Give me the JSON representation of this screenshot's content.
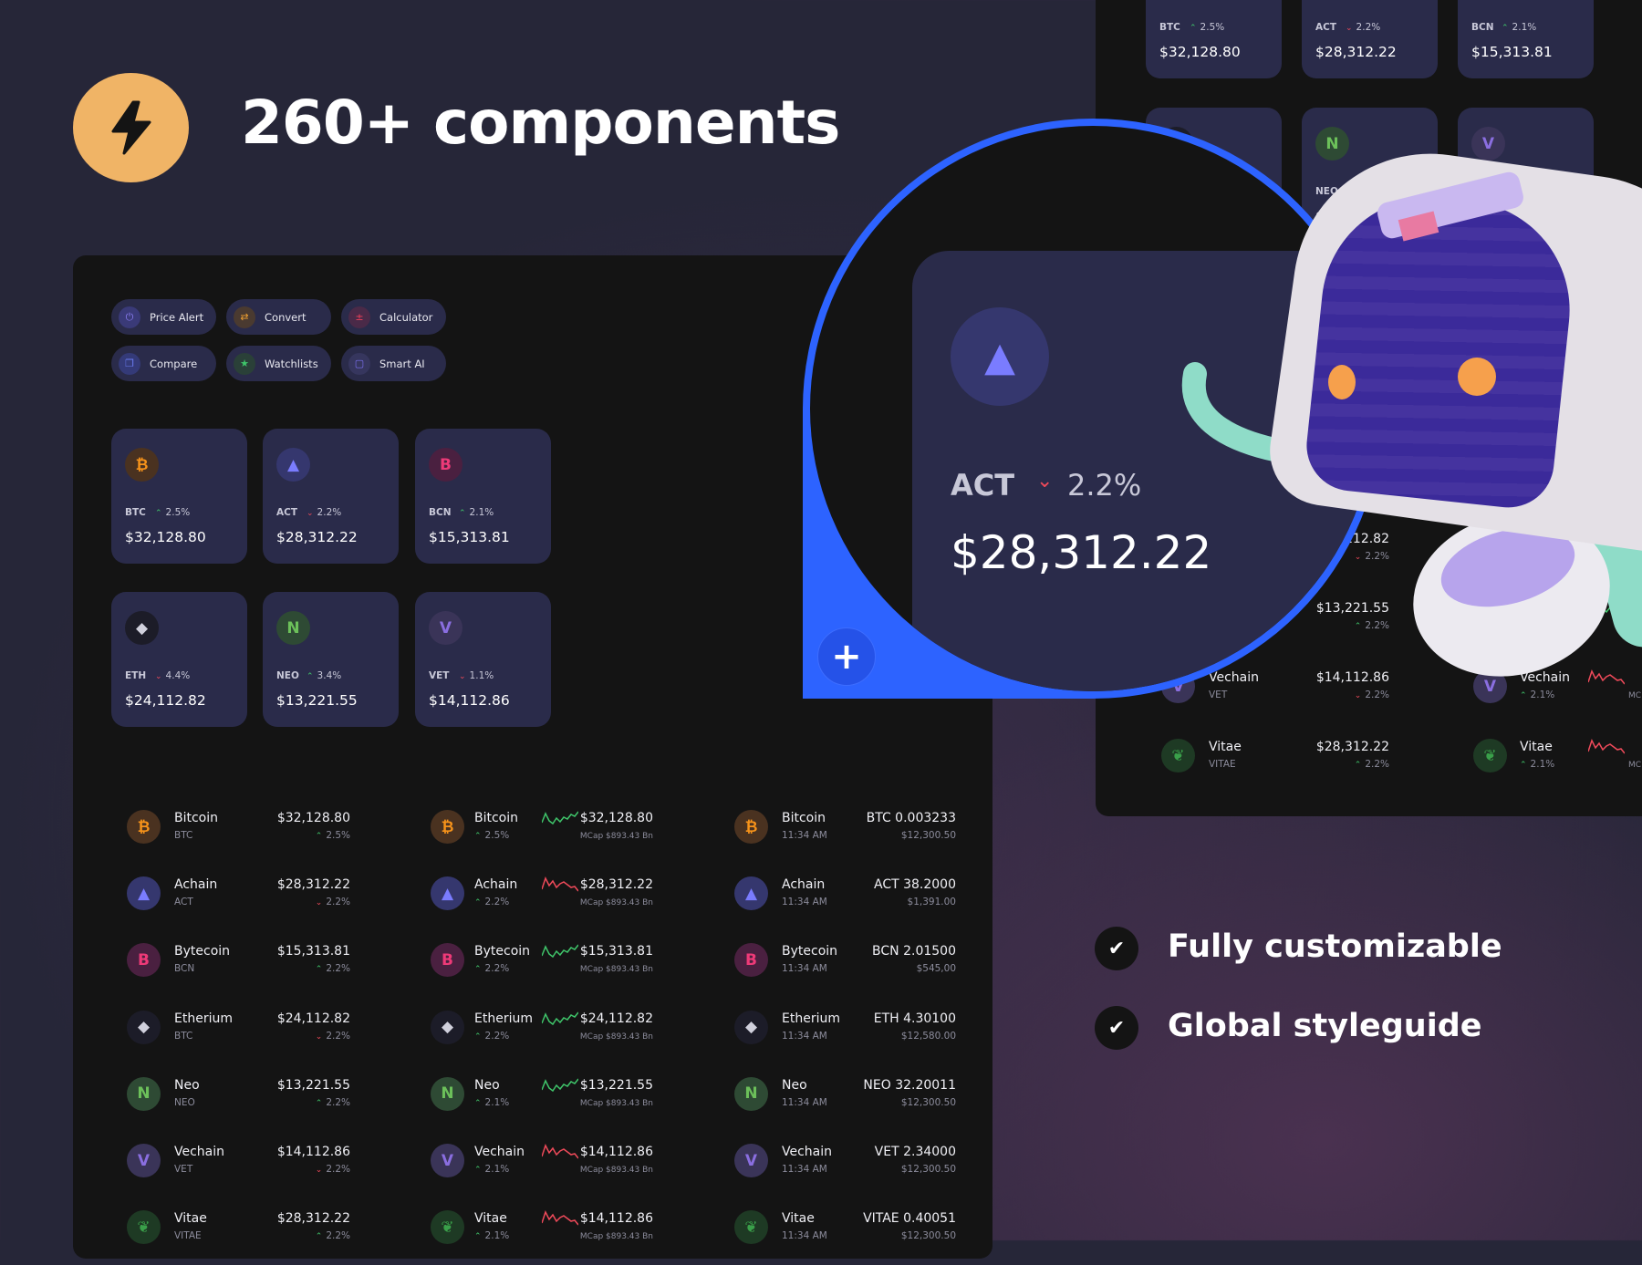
{
  "header": {
    "title": "260+ components",
    "logo_icon": "lightning-bolt-icon",
    "logo_color": "#f0b466"
  },
  "pills": [
    {
      "label": "Price Alert",
      "icon": "alarm-icon",
      "color": "#8a7cf0",
      "bg": "#3a3a78"
    },
    {
      "label": "Convert",
      "icon": "swap-icon",
      "color": "#f0a030",
      "bg": "#4a3a30"
    },
    {
      "label": "Calculator",
      "icon": "calculator-icon",
      "color": "#f0405a",
      "bg": "#4a2a48"
    },
    {
      "label": "Compare",
      "icon": "compare-icon",
      "color": "#6a7cf0",
      "bg": "#343a78"
    },
    {
      "label": "Watchlists",
      "icon": "star-icon",
      "color": "#3fc56a",
      "bg": "#2a4038"
    },
    {
      "label": "Smart AI",
      "icon": "robot-icon",
      "color": "#7a70f0",
      "bg": "#36365e"
    }
  ],
  "coins": {
    "btc": {
      "glyph": "₿",
      "fg": "#f7931a",
      "bg": "#4a3220"
    },
    "act": {
      "glyph": "▲",
      "fg": "#7a7cff",
      "bg": "#35376e"
    },
    "bcn": {
      "glyph": "B",
      "fg": "#ee3a78",
      "bg": "#4a2040"
    },
    "eth": {
      "glyph": "◆",
      "fg": "#d0d0dc",
      "bg": "#1c1c28"
    },
    "neo": {
      "glyph": "N",
      "fg": "#6cc05a",
      "bg": "#2e4a34"
    },
    "vet": {
      "glyph": "V",
      "fg": "#8a6ee0",
      "bg": "#3a3458"
    },
    "vitae": {
      "glyph": "❦",
      "fg": "#3aa04a",
      "bg": "#1e3a24"
    }
  },
  "cards": [
    {
      "coin": "btc",
      "symbol": "BTC",
      "dir": "up",
      "change": "2.5%",
      "price": "$32,128.80"
    },
    {
      "coin": "act",
      "symbol": "ACT",
      "dir": "down",
      "change": "2.2%",
      "price": "$28,312.22"
    },
    {
      "coin": "bcn",
      "symbol": "BCN",
      "dir": "up",
      "change": "2.1%",
      "price": "$15,313.81"
    },
    {
      "coin": "eth",
      "symbol": "ETH",
      "dir": "down",
      "change": "4.4%",
      "price": "$24,112.82"
    },
    {
      "coin": "neo",
      "symbol": "NEO",
      "dir": "up",
      "change": "3.4%",
      "price": "$13,221.55"
    },
    {
      "coin": "vet",
      "symbol": "VET",
      "dir": "down",
      "change": "1.1%",
      "price": "$14,112.86"
    }
  ],
  "list_simple": [
    {
      "coin": "btc",
      "name": "Bitcoin",
      "symbol": "BTC",
      "price": "$32,128.80",
      "dir": "up",
      "change": "2.5%"
    },
    {
      "coin": "act",
      "name": "Achain",
      "symbol": "ACT",
      "price": "$28,312.22",
      "dir": "down",
      "change": "2.2%"
    },
    {
      "coin": "bcn",
      "name": "Bytecoin",
      "symbol": "BCN",
      "price": "$15,313.81",
      "dir": "up",
      "change": "2.2%"
    },
    {
      "coin": "eth",
      "name": "Etherium",
      "symbol": "BTC",
      "price": "$24,112.82",
      "dir": "down",
      "change": "2.2%"
    },
    {
      "coin": "neo",
      "name": "Neo",
      "symbol": "NEO",
      "price": "$13,221.55",
      "dir": "up",
      "change": "2.2%"
    },
    {
      "coin": "vet",
      "name": "Vechain",
      "symbol": "VET",
      "price": "$14,112.86",
      "dir": "down",
      "change": "2.2%"
    },
    {
      "coin": "vitae",
      "name": "Vitae",
      "symbol": "VITAE",
      "price": "$28,312.22",
      "dir": "up",
      "change": "2.2%"
    }
  ],
  "list_spark": [
    {
      "coin": "btc",
      "name": "Bitcoin",
      "dir": "up",
      "change": "2.5%",
      "trend": "up",
      "price": "$32,128.80",
      "mcap": "MCap $893.43 Bn"
    },
    {
      "coin": "act",
      "name": "Achain",
      "dir": "up",
      "change": "2.2%",
      "trend": "down",
      "price": "$28,312.22",
      "mcap": "MCap $893.43 Bn"
    },
    {
      "coin": "bcn",
      "name": "Bytecoin",
      "dir": "up",
      "change": "2.2%",
      "trend": "up",
      "price": "$15,313.81",
      "mcap": "MCap $893.43 Bn"
    },
    {
      "coin": "eth",
      "name": "Etherium",
      "dir": "up",
      "change": "2.2%",
      "trend": "up",
      "price": "$24,112.82",
      "mcap": "MCap $893.43 Bn"
    },
    {
      "coin": "neo",
      "name": "Neo",
      "dir": "up",
      "change": "2.1%",
      "trend": "up",
      "price": "$13,221.55",
      "mcap": "MCap $893.43 Bn"
    },
    {
      "coin": "vet",
      "name": "Vechain",
      "dir": "up",
      "change": "2.1%",
      "trend": "down",
      "price": "$14,112.86",
      "mcap": "MCap $893.43 Bn"
    },
    {
      "coin": "vitae",
      "name": "Vitae",
      "dir": "up",
      "change": "2.1%",
      "trend": "down",
      "price": "$14,112.86",
      "mcap": "MCap $893.43 Bn"
    }
  ],
  "list_holdings": [
    {
      "coin": "btc",
      "name": "Bitcoin",
      "time": "11:34 AM",
      "amount": "BTC 0.003233",
      "value": "$12,300.50"
    },
    {
      "coin": "act",
      "name": "Achain",
      "time": "11:34 AM",
      "amount": "ACT 38.2000",
      "value": "$1,391.00"
    },
    {
      "coin": "bcn",
      "name": "Bytecoin",
      "time": "11:34 AM",
      "amount": "BCN 2.01500",
      "value": "$545,00"
    },
    {
      "coin": "eth",
      "name": "Etherium",
      "time": "11:34 AM",
      "amount": "ETH 4.30100",
      "value": "$12,580.00"
    },
    {
      "coin": "neo",
      "name": "Neo",
      "time": "11:34 AM",
      "amount": "NEO 32.20011",
      "value": "$12,300.50"
    },
    {
      "coin": "vet",
      "name": "Vechain",
      "time": "11:34 AM",
      "amount": "VET 2.34000",
      "value": "$12,300.50"
    },
    {
      "coin": "vitae",
      "name": "Vitae",
      "time": "11:34 AM",
      "amount": "VITAE 0.40051",
      "value": "$12,300.50"
    }
  ],
  "right_panel": {
    "mcap_partial": "MC"
  },
  "magnified": {
    "coin": "act",
    "symbol": "ACT",
    "dir": "down",
    "change": "2.2%",
    "price": "$28,312.22",
    "plus_label": "+"
  },
  "features": [
    {
      "label": "Fully customizable",
      "icon": "check-icon"
    },
    {
      "label": "Global styleguide",
      "icon": "check-icon"
    }
  ],
  "colors": {
    "up": "#3fc56a",
    "down": "#ef4a5a",
    "accent": "#2d63ff",
    "card": "#2a2b4a",
    "panel": "#141414"
  }
}
